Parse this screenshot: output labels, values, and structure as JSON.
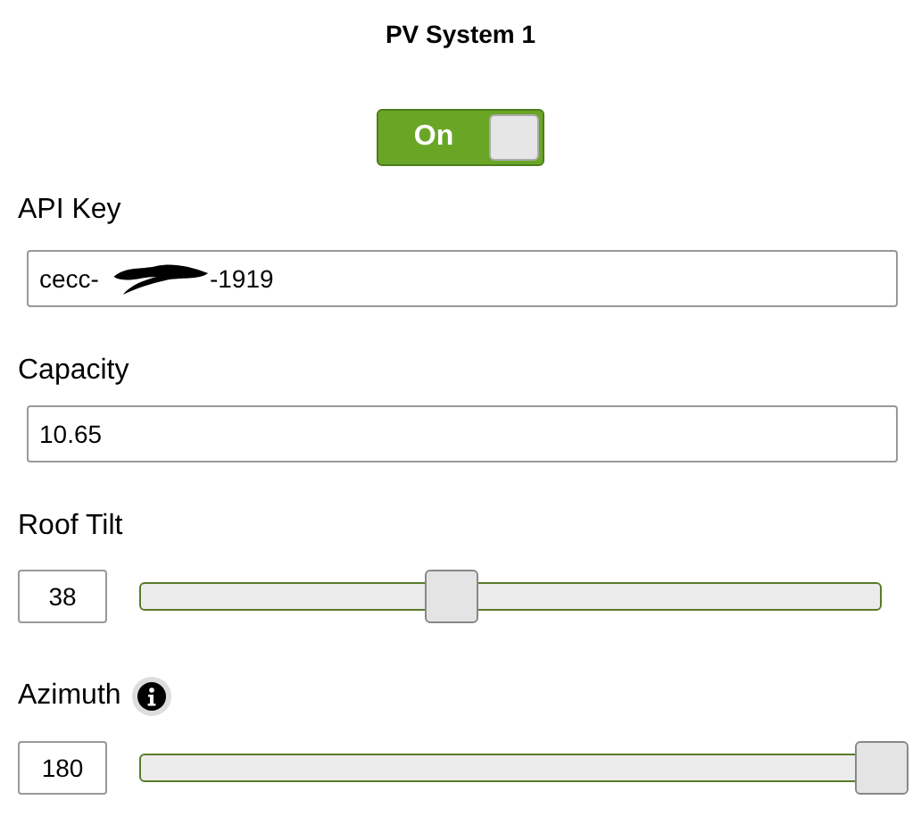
{
  "title": "PV System 1",
  "toggle": {
    "label": "On",
    "on": true
  },
  "api_key": {
    "label": "API Key",
    "value_start": "cecc-",
    "value_end": "-1919",
    "redacted": true
  },
  "capacity": {
    "label": "Capacity",
    "value": "10.65"
  },
  "sliders": [
    {
      "label": "Roof Tilt",
      "value": "38",
      "level": 0.42,
      "info": false
    },
    {
      "label": "Azimuth",
      "value": "180",
      "level": 1,
      "info": true
    }
  ]
}
